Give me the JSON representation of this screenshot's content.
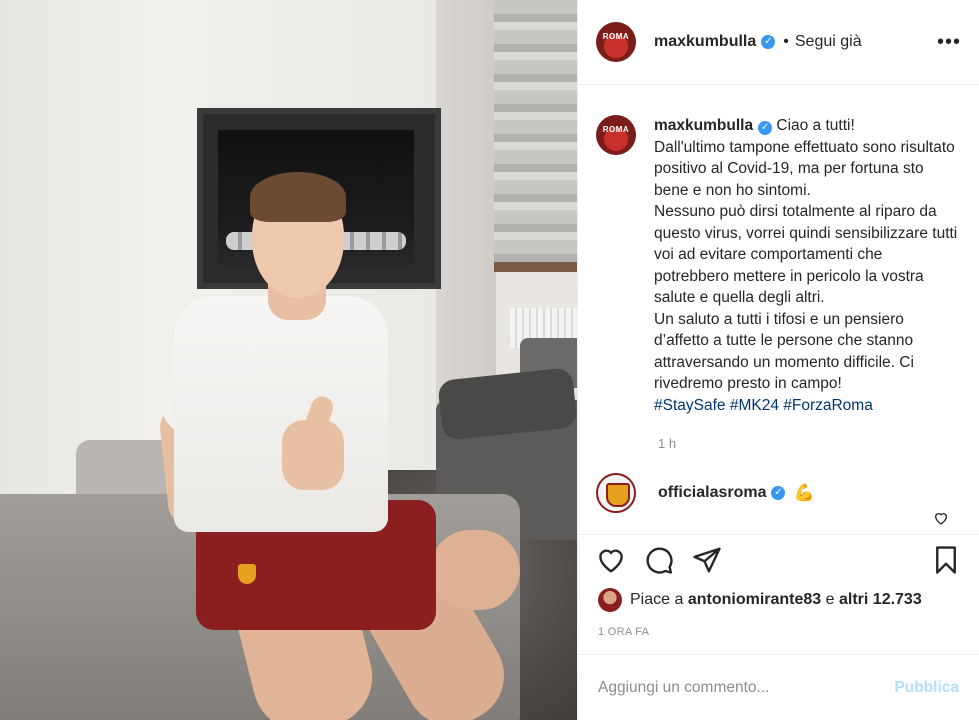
{
  "post": {
    "username": "maxkumbulla",
    "verified_symbol": "✓",
    "separator": "•",
    "follow_status": "Segui già",
    "more_symbol": "•••"
  },
  "caption": {
    "username": "maxkumbulla",
    "text": " Ciao a tutti!\nDall'ultimo tampone effettuato sono risultato positivo al Covid-19, ma per fortuna sto bene e non ho sintomi.\nNessuno può dirsi totalmente al riparo da questo virus, vorrei quindi sensibilizzare tutti voi ad evitare comportamenti che potrebbero mettere in pericolo la vostra salute e quella degli altri.\nUn saluto a tutti i tifosi e un pensiero d’affetto a tutte le persone che stanno attraversando un momento difficile. Ci rivedremo presto in campo!\n",
    "hashtags": "#StaySafe #MK24 #ForzaRoma",
    "time": "1 h"
  },
  "comment": {
    "username": "officialasroma",
    "emoji": "💪"
  },
  "likes": {
    "prefix": "Piace a ",
    "user": "antoniomirante83",
    "middle": " e ",
    "others": "altri 12.733"
  },
  "timestamp": "1 ORA FA",
  "add_comment": {
    "placeholder": "Aggiungi un commento...",
    "publish_label": "Pubblica"
  },
  "icons": {
    "like": "heart-icon",
    "comment": "comment-icon",
    "share": "share-icon",
    "save": "bookmark-icon",
    "comment_like": "heart-icon"
  },
  "colors": {
    "link": "#00376b",
    "verified": "#3897f0",
    "publish_disabled": "#b2dffc",
    "secondary_text": "#8e8e8e"
  }
}
